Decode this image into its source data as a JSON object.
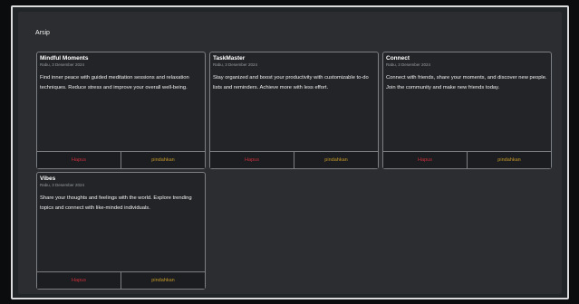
{
  "page": {
    "title": "Arsip"
  },
  "colors": {
    "delete": "#cc2f3b",
    "move": "#c79a2a",
    "background": "#2b2d30"
  },
  "cards": [
    {
      "title": "Mindful Moments",
      "date": "Rabu, 3 Desember 2024",
      "description": "Find inner peace with guided meditation sessions and relaxation techniques. Reduce stress and improve your overall well-being.",
      "delete_label": "Hapus",
      "move_label": "pindahkan"
    },
    {
      "title": "TaskMaster",
      "date": "Rabu, 3 Desember 2024",
      "description": "Stay organized and boost your productivity with customizable to-do lists and reminders. Achieve more with less effort.",
      "delete_label": "Hapus",
      "move_label": "pindahkan"
    },
    {
      "title": "Connect",
      "date": "Rabu, 3 Desember 2024",
      "description": "Connect with friends, share your moments, and discover new people. Join the community and make new friends today.",
      "delete_label": "Hapus",
      "move_label": "pindahkan"
    },
    {
      "title": "Vibes",
      "date": "Rabu, 3 Desember 2024",
      "description": "Share your thoughts and feelings with the world. Explore trending topics and connect with like-minded individuals.",
      "delete_label": "Hapus",
      "move_label": "pindahkan"
    }
  ]
}
